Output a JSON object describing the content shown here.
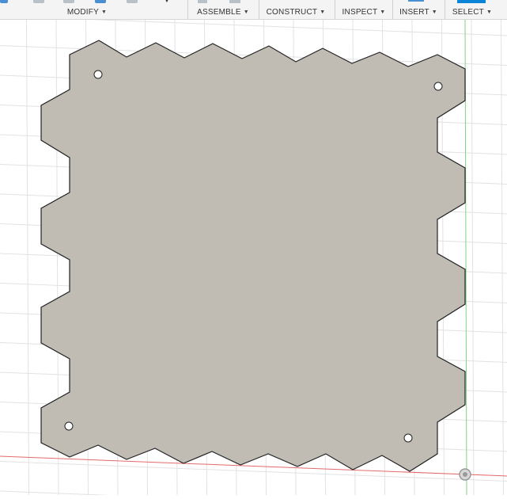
{
  "toolbar": {
    "modify": "MODIFY",
    "assemble": "ASSEMBLE",
    "construct": "CONSTRUCT",
    "inspect": "INSPECT",
    "insert": "INSERT",
    "select": "SELECT"
  },
  "colors": {
    "plate_fill": "#c0bcb4",
    "plate_stroke": "#222222",
    "grid": "#e2e2e2",
    "x_axis": "#e46a6a",
    "y_axis": "#7fd47f",
    "select_accent": "#0a84d6"
  },
  "icons": {
    "caret": "chevron-down-icon",
    "origin": "origin-icon"
  }
}
